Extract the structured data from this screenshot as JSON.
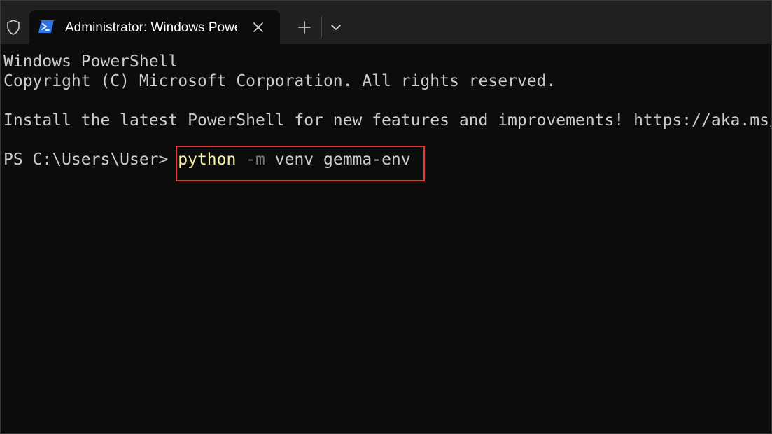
{
  "window": {
    "tab_title": "Administrator: Windows PowerShell",
    "tab_icon": "powershell-icon",
    "admin_icon": "shield-icon",
    "close_icon": "close-icon",
    "new_tab_icon": "plus-icon",
    "dropdown_icon": "chevron-down-icon"
  },
  "terminal": {
    "lines": [
      "Windows PowerShell",
      "Copyright (C) Microsoft Corporation. All rights reserved.",
      "",
      "Install the latest PowerShell for new features and improvements! https://aka.ms/PSWindows",
      ""
    ],
    "prompt": "PS C:\\Users\\User> ",
    "command": {
      "cmd": "python",
      "param": "-m",
      "args": "venv gemma-env"
    },
    "colors": {
      "background": "#0c0c0c",
      "foreground": "#cccccc",
      "command": "#f9f1a5",
      "parameter": "#767676",
      "highlight_border": "#e2383a"
    }
  }
}
